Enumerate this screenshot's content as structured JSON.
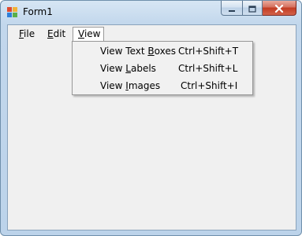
{
  "window": {
    "title": "Form1",
    "controls": {
      "minimize": "minimize-icon",
      "maximize": "maximize-icon",
      "close": "close-icon"
    }
  },
  "menubar": {
    "items": [
      {
        "label": "File",
        "mnemonic_index": 0
      },
      {
        "label": "Edit",
        "mnemonic_index": 0
      },
      {
        "label": "View",
        "mnemonic_index": 0,
        "open": true
      }
    ]
  },
  "view_menu": {
    "items": [
      {
        "label": "View Text Boxes",
        "mnemonic_index": 10,
        "shortcut": "Ctrl+Shift+T"
      },
      {
        "label": "View Labels",
        "mnemonic_index": 5,
        "shortcut": "Ctrl+Shift+L"
      },
      {
        "label": "View Images",
        "mnemonic_index": 5,
        "shortcut": "Ctrl+Shift+I"
      }
    ]
  },
  "colors": {
    "client_background": "#f0f0f0",
    "close_button": "#c23b22",
    "frame": "#bcd3ea"
  }
}
